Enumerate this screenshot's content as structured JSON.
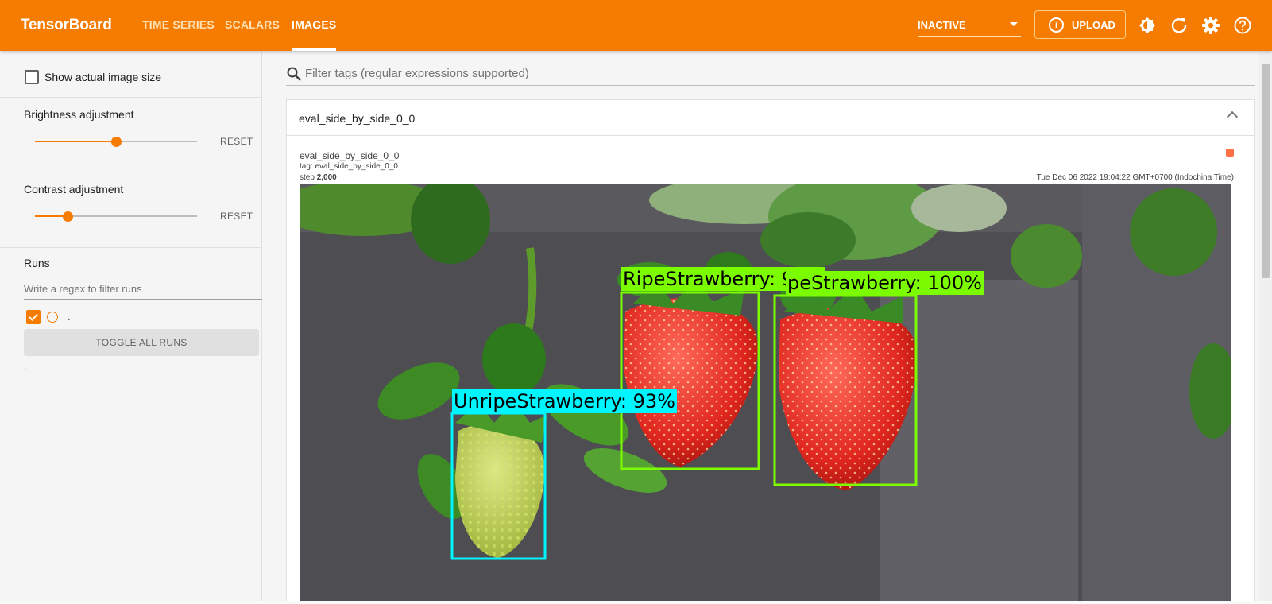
{
  "app": {
    "title": "TensorBoard"
  },
  "nav": {
    "tabs": [
      {
        "label": "TIME SERIES",
        "active": false
      },
      {
        "label": "SCALARS",
        "active": false
      },
      {
        "label": "IMAGES",
        "active": true
      }
    ]
  },
  "toolbar": {
    "run_state": "INACTIVE",
    "upload_label": "UPLOAD",
    "icons": [
      "theme-icon",
      "reload-icon",
      "settings-icon",
      "help-icon"
    ]
  },
  "sidebar": {
    "show_actual_size": {
      "label": "Show actual image size",
      "checked": false
    },
    "brightness": {
      "title": "Brightness adjustment",
      "reset_label": "RESET",
      "value": 0.5
    },
    "contrast": {
      "title": "Contrast adjustment",
      "reset_label": "RESET",
      "value": 0.2
    },
    "runs": {
      "title": "Runs",
      "filter_placeholder": "Write a regex to filter runs",
      "items": [
        {
          "name": ".",
          "checked": true,
          "color": "#f57c00"
        }
      ],
      "toggle_all_label": "TOGGLE ALL RUNS",
      "footer": "."
    }
  },
  "main": {
    "filter_placeholder": "Filter tags (regular expressions supported)",
    "card": {
      "title": "eval_side_by_side_0_0",
      "image_name": "eval_side_by_side_0_0",
      "tag": "tag: eval_side_by_side_0_0",
      "step_label": "step",
      "step_value": "2,000",
      "timestamp": "Tue Dec 06 2022 19:04:22 GMT+0700 (Indochina Time)",
      "detections": [
        {
          "label": "RipeStrawberry: 98%",
          "color": "#7cfc00"
        },
        {
          "label": "peStrawberry: 100%",
          "color": "#7cfc00"
        },
        {
          "label": "UnripeStrawberry: 93%",
          "color": "#00f5ff"
        }
      ]
    }
  },
  "colors": {
    "accent": "#f57c00",
    "ripe_box": "#7cfc00",
    "unripe_box": "#00f5ff"
  }
}
